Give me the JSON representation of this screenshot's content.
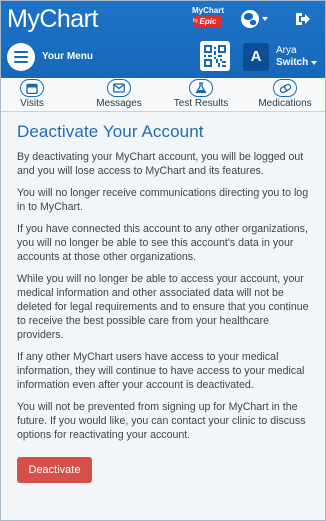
{
  "header": {
    "logo_text": "MyChart",
    "epic_badge_top": "MyChart",
    "epic_badge_by": "by",
    "epic_badge_logo": "Epic",
    "menu_label": "Your Menu",
    "avatar_initial": "A",
    "user_name": "Arya",
    "switch_label": "Switch",
    "icons": [
      "globe-icon",
      "logout-icon",
      "menu-icon",
      "qr-code-icon"
    ]
  },
  "tabs": [
    {
      "label": "Visits",
      "icon": "calendar-icon"
    },
    {
      "label": "Messages",
      "icon": "envelope-icon"
    },
    {
      "label": "Test Results",
      "icon": "flask-icon"
    },
    {
      "label": "Medications",
      "icon": "pill-icon"
    }
  ],
  "main": {
    "title": "Deactivate Your Account",
    "paragraphs": [
      "By deactivating your MyChart account, you will be logged out and you will lose access to MyChart and its features.",
      "You will no longer receive communications directing you to log in to MyChart.",
      "If you have connected this account to any other organizations, you will no longer be able to see this account's data in your accounts at those other organizations.",
      "While you will no longer be able to access your account, your medical information and other associated data will not be deleted for legal requirements and to ensure that you continue to receive the best possible care from your healthcare providers.",
      "If any other MyChart users have access to your medical information, they will continue to have access to your medical information even after your account is deactivated.",
      "You will not be prevented from signing up for MyChart in the future. If you would like, you can contact your clinic to discuss options for reactivating your account."
    ],
    "deactivate_button": "Deactivate"
  },
  "colors": {
    "header_blue": "#1668b9",
    "title_blue": "#1f6bb8",
    "button_red": "#d65049"
  }
}
